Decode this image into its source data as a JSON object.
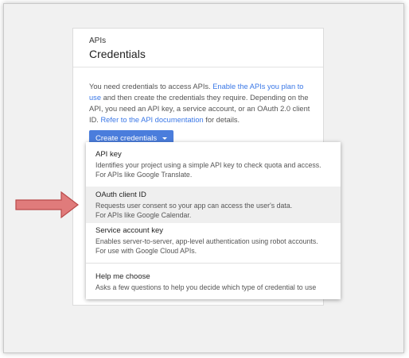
{
  "header": {
    "breadcrumb": "APIs",
    "title": "Credentials"
  },
  "description": {
    "part1": "You need credentials to access APIs. ",
    "link1": "Enable the APIs you plan to use",
    "part2": " and then create the credentials they require. Depending on the API, you need an API key, a service account, or an OAuth 2.0 client ID. ",
    "link2": "Refer to the API documentation",
    "part3": " for details."
  },
  "create_button": {
    "label": "Create credentials"
  },
  "menu": {
    "items": [
      {
        "title": "API key",
        "line1": "Identifies your project using a simple API key to check quota and access.",
        "line2": "For APIs like Google Translate."
      },
      {
        "title": "OAuth client ID",
        "line1": "Requests user consent so your app can access the user's data.",
        "line2": "For APIs like Google Calendar."
      },
      {
        "title": "Service account key",
        "line1": "Enables server-to-server, app-level authentication using robot accounts.",
        "line2": "For use with Google Cloud APIs."
      },
      {
        "title": "Help me choose",
        "line1": "Asks a few questions to help you decide which type of credential to use"
      }
    ]
  },
  "colors": {
    "accent": "#4a7ddc",
    "link": "#3b78e7",
    "arrow": "#e07b7b",
    "arrow_stroke": "#b94a4a"
  }
}
